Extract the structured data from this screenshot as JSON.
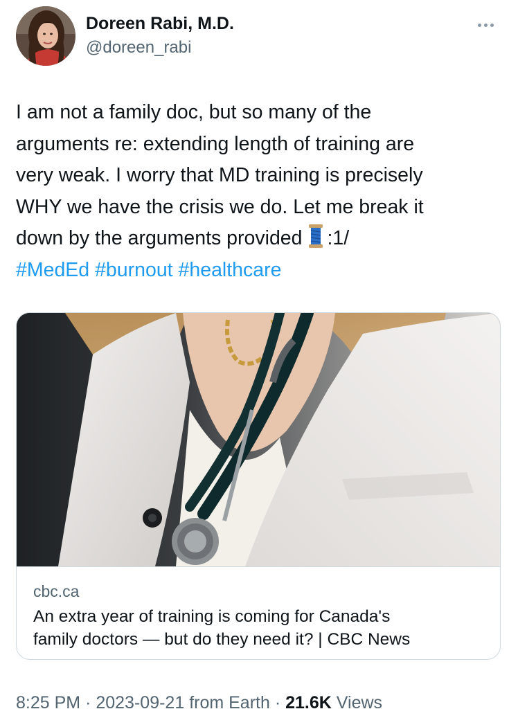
{
  "author": {
    "name": "Doreen Rabi, M.D.",
    "handle": "@doreen_rabi",
    "avatar_icon": "profile-photo"
  },
  "tweet": {
    "lines": [
      "I am not a family doc, but so many of the",
      "arguments re: extending length of training are",
      "very weak.  I worry that MD training is precisely",
      "WHY we have the crisis we do.  Let me break it",
      "down by the arguments provided"
    ],
    "thread_marker": ":1/",
    "thread_emoji": "spool-of-thread-icon",
    "hashtags": [
      "#MedEd",
      "#burnout",
      "#healthcare"
    ]
  },
  "card": {
    "domain": "cbc.ca",
    "title_lines": [
      "An extra year of training is coming for Canada's",
      "family doctors — but do they need it? | CBC News"
    ],
    "image": "doctor-with-stethoscope-photo"
  },
  "footer": {
    "time": "8:25 PM",
    "date": "2023-09-21",
    "source": "from Earth",
    "separator": "·",
    "views_count": "21.6K",
    "views_label": "Views"
  },
  "colors": {
    "link": "#1d9bf0",
    "secondary_text": "#536471",
    "border": "#cfd9de"
  }
}
